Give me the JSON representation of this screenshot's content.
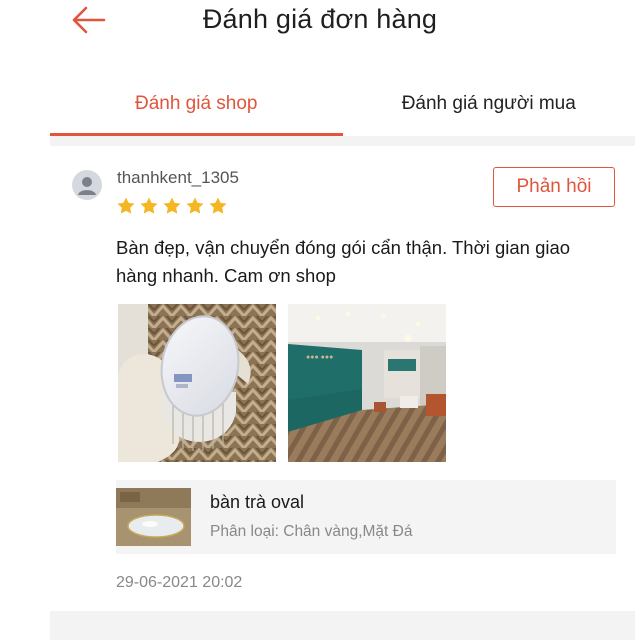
{
  "header": {
    "title": "Đánh giá đơn hàng",
    "back_icon": "arrow-left-icon",
    "accent_color": "#e0553b"
  },
  "tabs": [
    {
      "label": "Đánh giá shop",
      "active": true
    },
    {
      "label": "Đánh giá người mua",
      "active": false
    }
  ],
  "review": {
    "username": "thanhkent_1305",
    "avatar_icon": "user-avatar-icon",
    "rating": 5,
    "star_color": "#f5b623",
    "reply_label": "Phản hồi",
    "text": "Bàn đẹp, vận chuyển đóng gói cẩn thận. Thời gian giao hàng nhanh. Cam ơn shop",
    "photos": [
      "review-photo-table",
      "review-photo-shop-interior"
    ],
    "product": {
      "name": "bàn trà oval",
      "variant": "Phân loại: Chân vàng,Mặt Đá"
    },
    "date": "29-06-2021 20:02"
  }
}
